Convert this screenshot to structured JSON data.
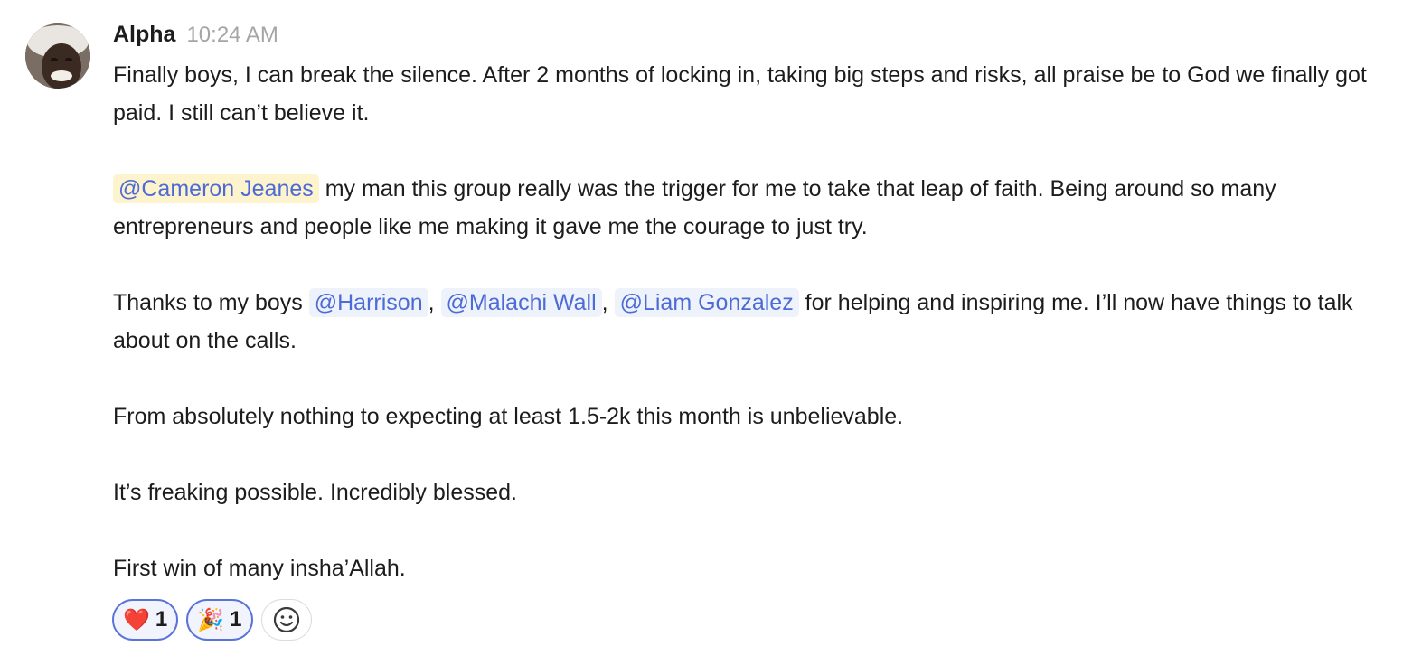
{
  "message": {
    "author": "Alpha",
    "timestamp": "10:24 AM",
    "paragraph1": "Finally boys, I can break the silence. After 2 months of locking in, taking big steps and risks, all praise be to God we finally got paid. I still can’t believe it.",
    "paragraph2": {
      "mention": "@Cameron Jeanes",
      "text": " my man this group really was the trigger for me to take that leap of faith. Being around so many entrepreneurs and people like me making it gave me the courage to just try."
    },
    "paragraph3": {
      "prefix": "Thanks to my boys ",
      "mention1": "@Harrison",
      "sep1": ", ",
      "mention2": "@Malachi Wall",
      "sep2": ", ",
      "mention3": "@Liam Gonzalez",
      "suffix": "  for helping and inspiring me. I’ll now have things to talk about on the calls."
    },
    "paragraph4": "From absolutely nothing to expecting at least 1.5-2k this month is unbelievable.",
    "paragraph5": "It’s freaking possible. Incredibly blessed.",
    "paragraph6": "First win of many insha’Allah."
  },
  "reactions": [
    {
      "emoji": "❤️",
      "icon": "heart-icon",
      "count": "1"
    },
    {
      "emoji": "🎉",
      "icon": "party-popper-icon",
      "count": "1"
    }
  ],
  "add_reaction_icon": "smiley-icon",
  "colors": {
    "mention_text": "#4d6bd6",
    "mention_bg": "#eef2fb",
    "highlight_mention_bg": "#fdf3cd",
    "reaction_border": "#5a73d9",
    "timestamp": "#a5a5a8"
  }
}
